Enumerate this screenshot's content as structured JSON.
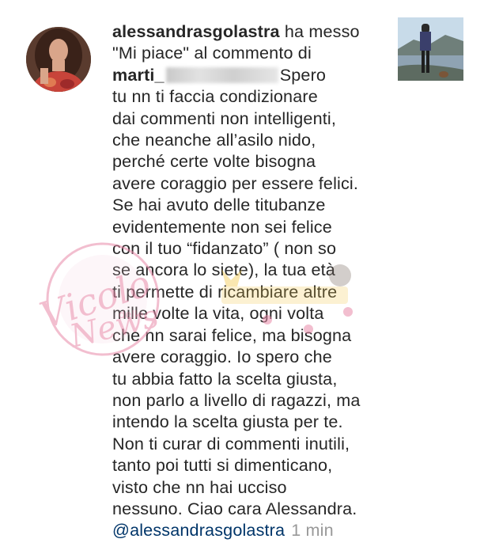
{
  "notification": {
    "actor_username": "alessandrasgolastra",
    "action_line1": " ha messo",
    "action_line2": "\"Mi piace\" al commento di",
    "commenter_visible": "marti_",
    "comment_line3_end": "Spero",
    "comment_lines": [
      "tu nn ti faccia condizionare",
      "dai commenti non intelligenti,",
      "che neanche all’asilo nido,",
      "perché certe volte bisogna",
      "avere coraggio per essere felici.",
      "Se hai avuto delle titubanze",
      "evidentemente non sei felice",
      "con il tuo “fidanzato” ( non so",
      "se ancora lo siete), la tua età",
      "ti permette di ricambiare altre",
      "mille volte la vita, ogni volta",
      "che nn sarai felice, ma bisogna",
      "avere coraggio. Io spero che",
      "tu abbia fatto la scelta giusta,",
      "non parlo a livello di ragazzi, ma",
      "intendo la scelta giusta per te.",
      "Non ti curar di commenti inutili,",
      "tanto poi tutti si dimenticano,",
      "visto che nn hai ucciso",
      "nessuno. Ciao cara Alessandra."
    ],
    "mention": "@alessandrasgolastra",
    "timestamp": "1 min"
  },
  "watermark": {
    "script_text": "Vicolo delle News"
  },
  "colors": {
    "text": "#262626",
    "mention": "#003569",
    "timestamp": "#999999",
    "watermark": "#e88aa8"
  }
}
